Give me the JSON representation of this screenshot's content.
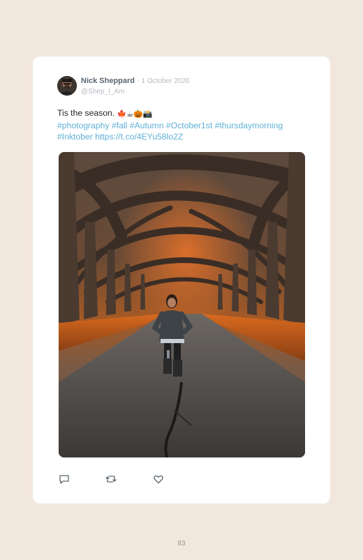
{
  "post": {
    "author_name": "Nick Sheppard",
    "separator": "·",
    "date": "1 October 2020",
    "handle": "@Shep_I_Am",
    "text": "Tis the season.",
    "emojis": [
      "🍁",
      "☕",
      "🎃",
      "📸"
    ],
    "hashtags": [
      "#photography",
      "#fall",
      "#Autumn",
      "#October1st",
      "#thursdaymorning",
      "#Inktober"
    ],
    "link": "https://t.co/4EYu58lo2Z"
  },
  "actions": {
    "reply_icon": "reply-icon",
    "retweet_icon": "retweet-icon",
    "like_icon": "like-icon"
  },
  "page_number": "83"
}
